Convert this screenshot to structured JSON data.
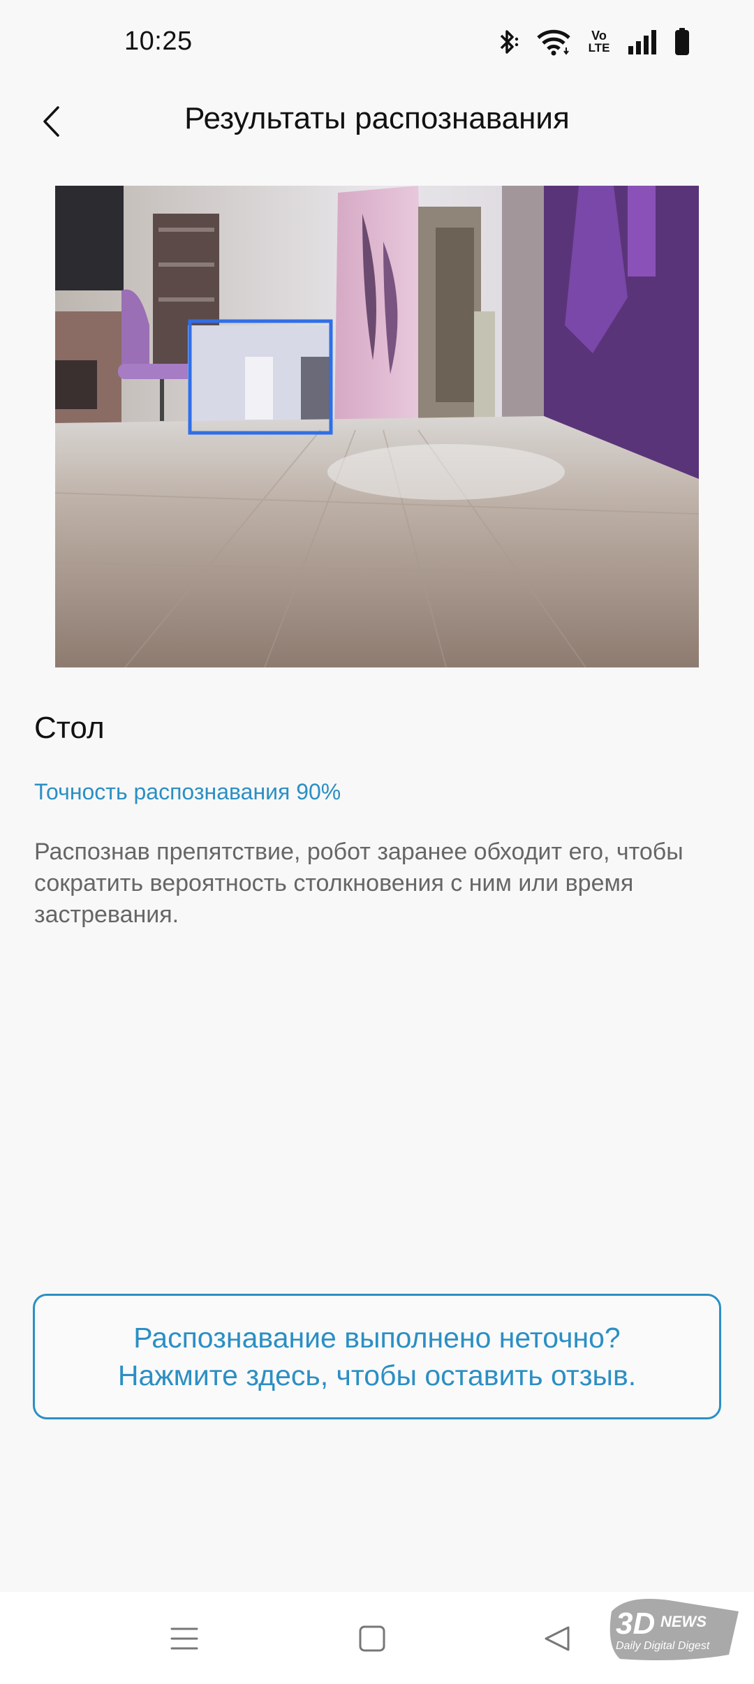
{
  "status_bar": {
    "time": "10:25",
    "icons": [
      "bluetooth-icon",
      "wifi-icon",
      "volte-icon",
      "signal-icon",
      "battery-icon"
    ],
    "volte_top": "Vo",
    "volte_bottom": "LTE"
  },
  "header": {
    "title": "Результаты распознавания",
    "back_icon": "chevron-left-icon"
  },
  "result": {
    "object_name": "Стол",
    "accuracy": "Точность распознавания 90%",
    "description": "Распознав препятствие, робот заранее обходит его, чтобы сократить вероятность столкновения с ним или время застревания."
  },
  "feedback": {
    "line1": "Распознавание выполнено неточно?",
    "line2": "Нажмите здесь, чтобы оставить отзыв."
  },
  "nav_bar": {
    "icons": [
      "menu-icon",
      "home-square-icon",
      "back-triangle-icon"
    ]
  },
  "watermark": {
    "brand": "3DNEWS",
    "tagline": "Daily Digital Digest"
  },
  "colors": {
    "accent": "#2b8fc4",
    "detection_box": "#2f6fe8",
    "background": "#f8f8f8"
  }
}
